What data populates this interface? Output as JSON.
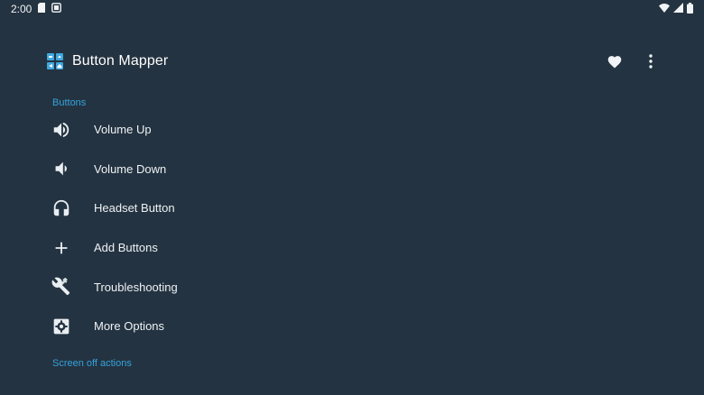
{
  "status_bar": {
    "time": "2:00",
    "icons": [
      "sim-card-icon",
      "screenshot-icon",
      "wifi-icon",
      "signal-icon",
      "battery-icon"
    ]
  },
  "app_bar": {
    "title": "Button Mapper",
    "logo_icon": "button-mapper-logo",
    "actions": [
      "favorite-heart-icon",
      "more-vert-icon"
    ]
  },
  "sections": {
    "buttons_header": "Buttons",
    "screen_off_header": "Screen off actions"
  },
  "items": [
    {
      "label": "Volume Up",
      "icon": "volume-up-icon"
    },
    {
      "label": "Volume Down",
      "icon": "volume-down-icon"
    },
    {
      "label": "Headset Button",
      "icon": "headset-icon"
    },
    {
      "label": "Add Buttons",
      "icon": "add-icon"
    },
    {
      "label": "Troubleshooting",
      "icon": "tools-icon"
    },
    {
      "label": "More Options",
      "icon": "gear-icon"
    }
  ],
  "colors": {
    "background": "#243341",
    "accent": "#33a3dc",
    "text": "#eef2f5"
  }
}
